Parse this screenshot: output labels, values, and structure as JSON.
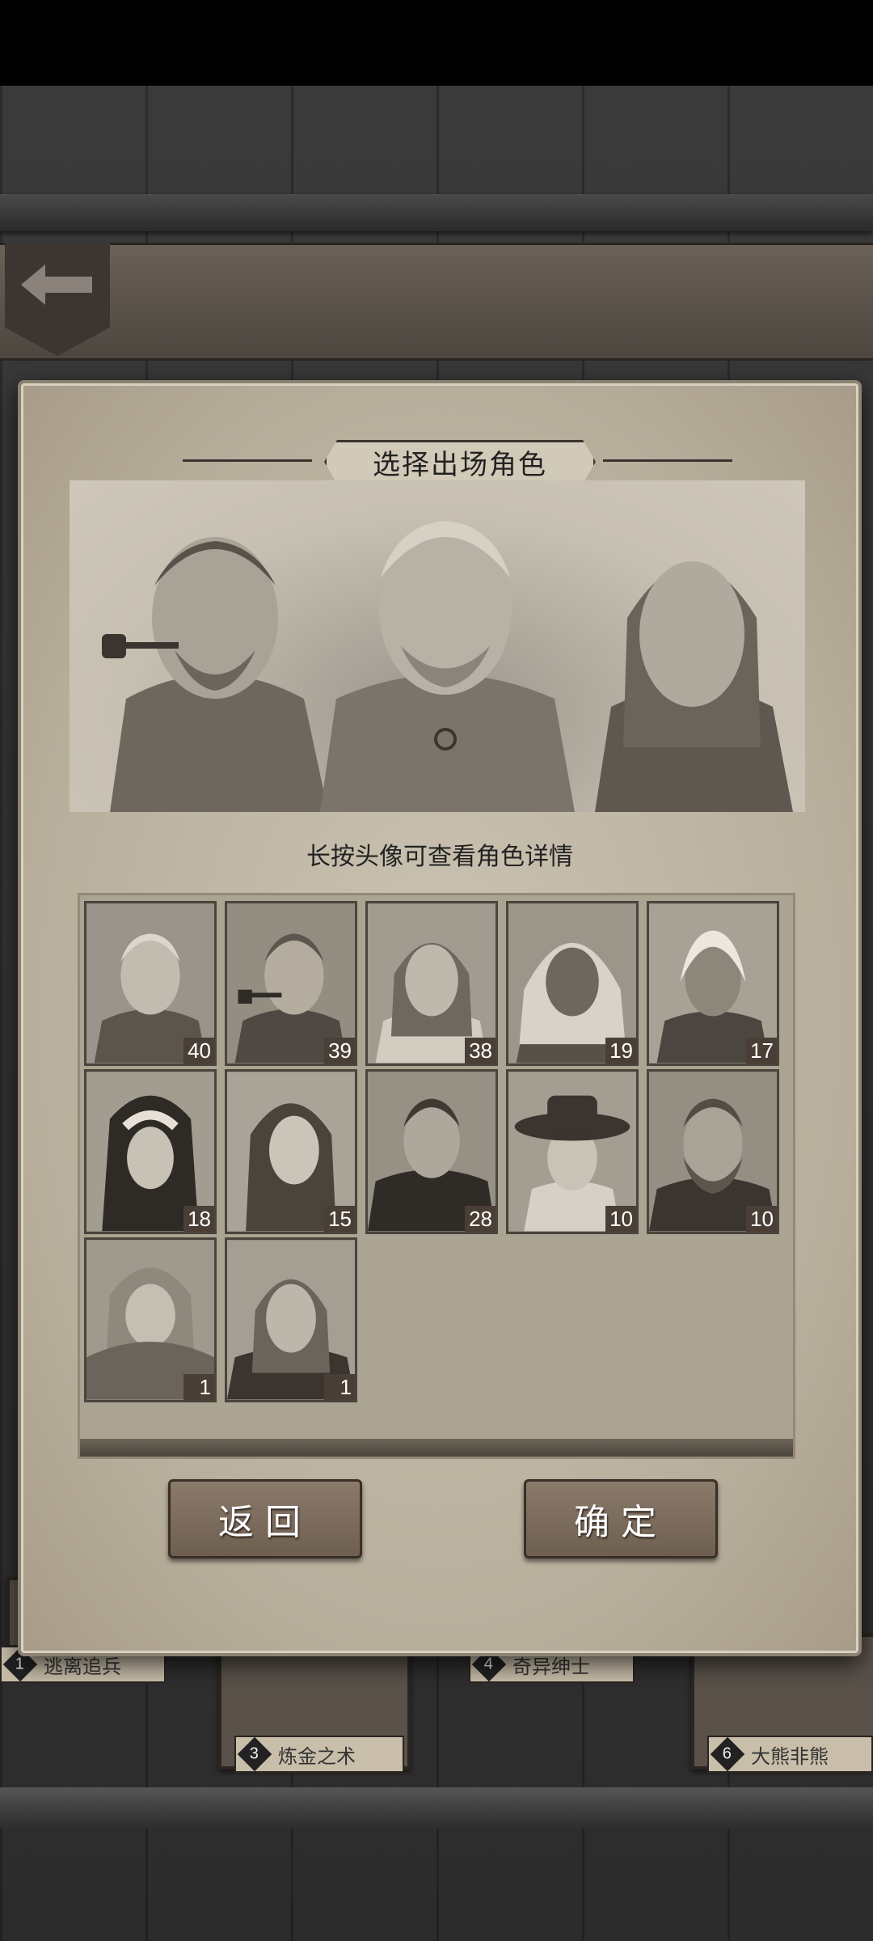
{
  "dialog": {
    "title": "选择出场角色",
    "hint": "长按头像可查看角色详情",
    "back_label": "返回",
    "confirm_label": "确定"
  },
  "characters": [
    {
      "level": "40",
      "icon": "blond-man-portrait"
    },
    {
      "level": "39",
      "icon": "pipe-man-portrait"
    },
    {
      "level": "38",
      "icon": "ponytail-woman-portrait"
    },
    {
      "level": "19",
      "icon": "curly-hair-woman-portrait"
    },
    {
      "level": "17",
      "icon": "white-hair-man-portrait"
    },
    {
      "level": "18",
      "icon": "nun-portrait"
    },
    {
      "level": "15",
      "icon": "long-hair-woman-portrait"
    },
    {
      "level": "28",
      "icon": "cloaked-man-portrait"
    },
    {
      "level": "10",
      "icon": "hat-woman-portrait"
    },
    {
      "level": "10",
      "icon": "bearded-man-portrait"
    },
    {
      "level": "1",
      "icon": "scarf-girl-portrait"
    },
    {
      "level": "1",
      "icon": "long-hair-man-portrait"
    }
  ],
  "background_levels": [
    {
      "num": "1",
      "label": "逃离追兵"
    },
    {
      "num": "3",
      "label": "炼金之术"
    },
    {
      "num": "4",
      "label": "奇异绅士"
    },
    {
      "num": "6",
      "label": "大熊非熊"
    }
  ],
  "colors": {
    "parchment": "#c4bcac",
    "button_wood": "#7c6c5e",
    "badge": "#4a3f36"
  }
}
